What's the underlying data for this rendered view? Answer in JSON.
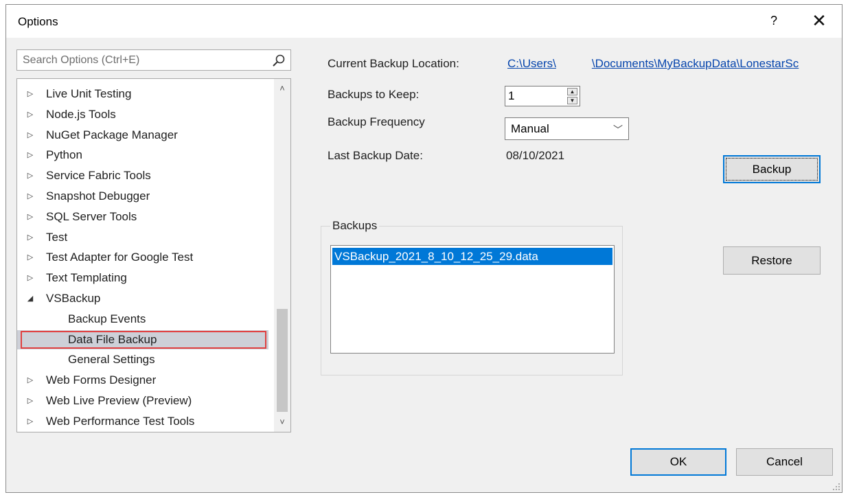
{
  "window": {
    "title": "Options",
    "help_label": "?",
    "close_label": "✕"
  },
  "search": {
    "placeholder": "Search Options (Ctrl+E)",
    "icon": "search-icon"
  },
  "tree": {
    "items": [
      {
        "label": "Live Unit Testing",
        "expanded": false,
        "level": 0
      },
      {
        "label": "Node.js Tools",
        "expanded": false,
        "level": 0
      },
      {
        "label": "NuGet Package Manager",
        "expanded": false,
        "level": 0
      },
      {
        "label": "Python",
        "expanded": false,
        "level": 0
      },
      {
        "label": "Service Fabric Tools",
        "expanded": false,
        "level": 0
      },
      {
        "label": "Snapshot Debugger",
        "expanded": false,
        "level": 0
      },
      {
        "label": "SQL Server Tools",
        "expanded": false,
        "level": 0
      },
      {
        "label": "Test",
        "expanded": false,
        "level": 0
      },
      {
        "label": "Test Adapter for Google Test",
        "expanded": false,
        "level": 0
      },
      {
        "label": "Text Templating",
        "expanded": false,
        "level": 0
      },
      {
        "label": "VSBackup",
        "expanded": true,
        "level": 0
      },
      {
        "label": "Backup Events",
        "level": 1
      },
      {
        "label": "Data File Backup",
        "level": 1,
        "selected": true
      },
      {
        "label": "General Settings",
        "level": 1
      },
      {
        "label": "Web Forms Designer",
        "expanded": false,
        "level": 0
      },
      {
        "label": "Web Live Preview (Preview)",
        "expanded": false,
        "level": 0
      },
      {
        "label": "Web Performance Test Tools",
        "expanded": false,
        "level": 0
      }
    ],
    "collapsed_glyph": "▷",
    "expanded_glyph": "◢",
    "scroll_up_glyph": "˄",
    "scroll_down_glyph": "˅"
  },
  "settings": {
    "location_label": "Current Backup Location:",
    "location_path_start": "C:\\Users\\",
    "location_path_end": "\\Documents\\MyBackupData\\LonestarSc",
    "keep_label": "Backups to Keep:",
    "keep_value": "1",
    "frequency_label": "Backup Frequency",
    "frequency_value": "Manual",
    "last_date_label": "Last Backup Date:",
    "last_date_value": "08/10/2021"
  },
  "backups": {
    "group_title": "Backups",
    "items": [
      "VSBackup_2021_8_10_12_25_29.data"
    ]
  },
  "buttons": {
    "backup": "Backup",
    "restore": "Restore",
    "ok": "OK",
    "cancel": "Cancel"
  },
  "colors": {
    "accent": "#0078d7",
    "highlight_border": "#e04040",
    "link": "#0645ad"
  }
}
